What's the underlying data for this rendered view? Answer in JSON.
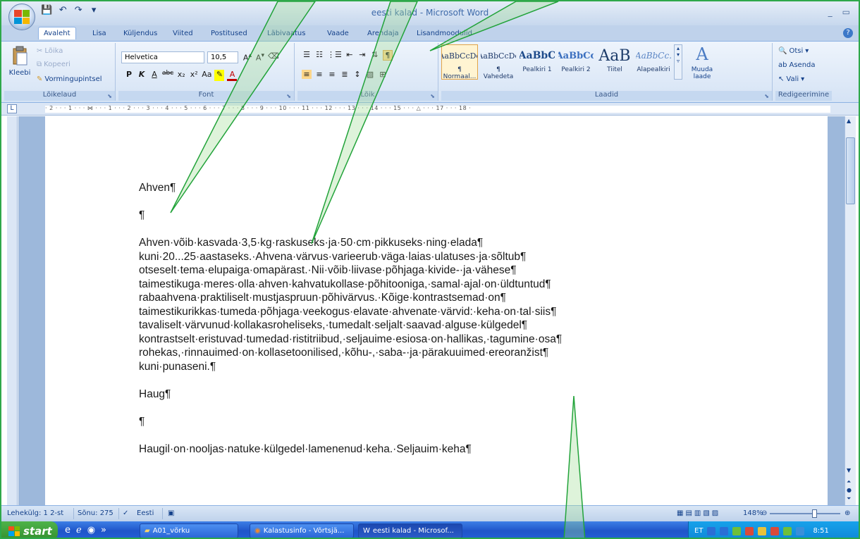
{
  "window": {
    "title": "eesti kalad - Microsoft Word",
    "controls": [
      "_",
      "▭",
      "✕"
    ]
  },
  "qat": {
    "save_icon": "💾",
    "undo_icon": "↶",
    "redo_icon": "↷",
    "more_icon": "▾"
  },
  "tabs": [
    "Avaleht",
    "Lisa",
    "Küljendus",
    "Viited",
    "Postitused",
    "Läbivaatus",
    "Vaade",
    "Arendaja",
    "Lisandmoodulid"
  ],
  "ribbon": {
    "clipboard": {
      "label": "Lõikelaud",
      "paste": "Kleebi",
      "cut": "Lõika",
      "copy": "Kopeeri",
      "format_painter": "Vormingupintsel"
    },
    "font": {
      "label": "Font",
      "name": "Helvetica",
      "size": "10,5"
    },
    "paragraph": {
      "label": "Lõik"
    },
    "styles": {
      "label": "Laadid",
      "items": [
        {
          "preview": "AaBbCcDc",
          "name": "¶ Normaal..."
        },
        {
          "preview": "AaBbCcDc",
          "name": "¶ Vahedeta"
        },
        {
          "preview": "AaBbC",
          "name": "Pealkiri 1"
        },
        {
          "preview": "AaBbCc",
          "name": "Pealkiri 2"
        },
        {
          "preview": "AaB",
          "name": "Tiitel"
        },
        {
          "preview": "AaBbCc.",
          "name": "Alapealkiri"
        }
      ],
      "change": "Muuda laade"
    },
    "editing": {
      "label": "Redigeerimine",
      "find": "Otsi",
      "replace": "Asenda",
      "select": "Vali"
    }
  },
  "ruler": {
    "numbers": "· 2 · · · 1 · · · ⋈ · · · 1 · · · 2 · · · 3 · · · 4 · · · 5 · · · 6 · · · 7 · · · 8 · · · 9 · · · 10 · · · 11 · · · 12 · · · 13 · · · 14 · · · 15 · · · △ · · · 17 · · · 18 ·"
  },
  "document": {
    "lines": [
      "Ahven¶",
      "",
      "¶",
      "",
      "Ahven·võib·kasvada·3,5·kg·raskuseks·ja·50·cm·pikkuseks·ning·elada¶",
      "kuni·20...25·aastaseks.·Ahvena·värvus·varieerub·väga·laias·ulatuses·ja·sõltub¶",
      "otseselt·tema·elupaiga·omapärast.·Nii·võib·liivase·põhjaga·kivide-·ja·vähese¶",
      "taimestikuga·meres·olla·ahven·kahvatukollase·põhitooniga,·samal·ajal·on·üldtuntud¶",
      "rabaahvena·praktiliselt·mustjaspruun·põhivärvus.·Kõige·kontrastsemad·on¶",
      "taimestikurikkas·tumeda·põhjaga·veekogus·elavate·ahvenate·värvid:·keha·on·tal·siis¶",
      "tavaliselt·värvunud·kollakasroheliseks,·tumedalt·seljalt·saavad·alguse·külgedel¶",
      "kontrastselt·eristuvad·tumedad·ristitriibud,·seljauime·esiosa·on·hallikas,·tagumine·osa¶",
      "rohekas,·rinnauimed·on·kollasetoonilised,·kõhu-,·saba-·ja·pärakuuimed·ereoranžist¶",
      "kuni·punaseni.¶",
      "",
      "Haug¶",
      "",
      "¶",
      "",
      "Haugil·on·nooljas·natuke·külgedel·lamenenud·keha.·Seljauim·keha¶"
    ]
  },
  "status": {
    "page": "Lehekülg: 1 2-st",
    "words": "Sõnu: 275",
    "language": "Eesti",
    "zoom": "148%"
  },
  "taskbar": {
    "start": "start",
    "tasks": [
      "A01_võrku",
      "Kalastusinfo - Võrtsjä...",
      "eesti kalad - Microsof..."
    ],
    "tray_lang": "ET",
    "clock": "8:51"
  }
}
